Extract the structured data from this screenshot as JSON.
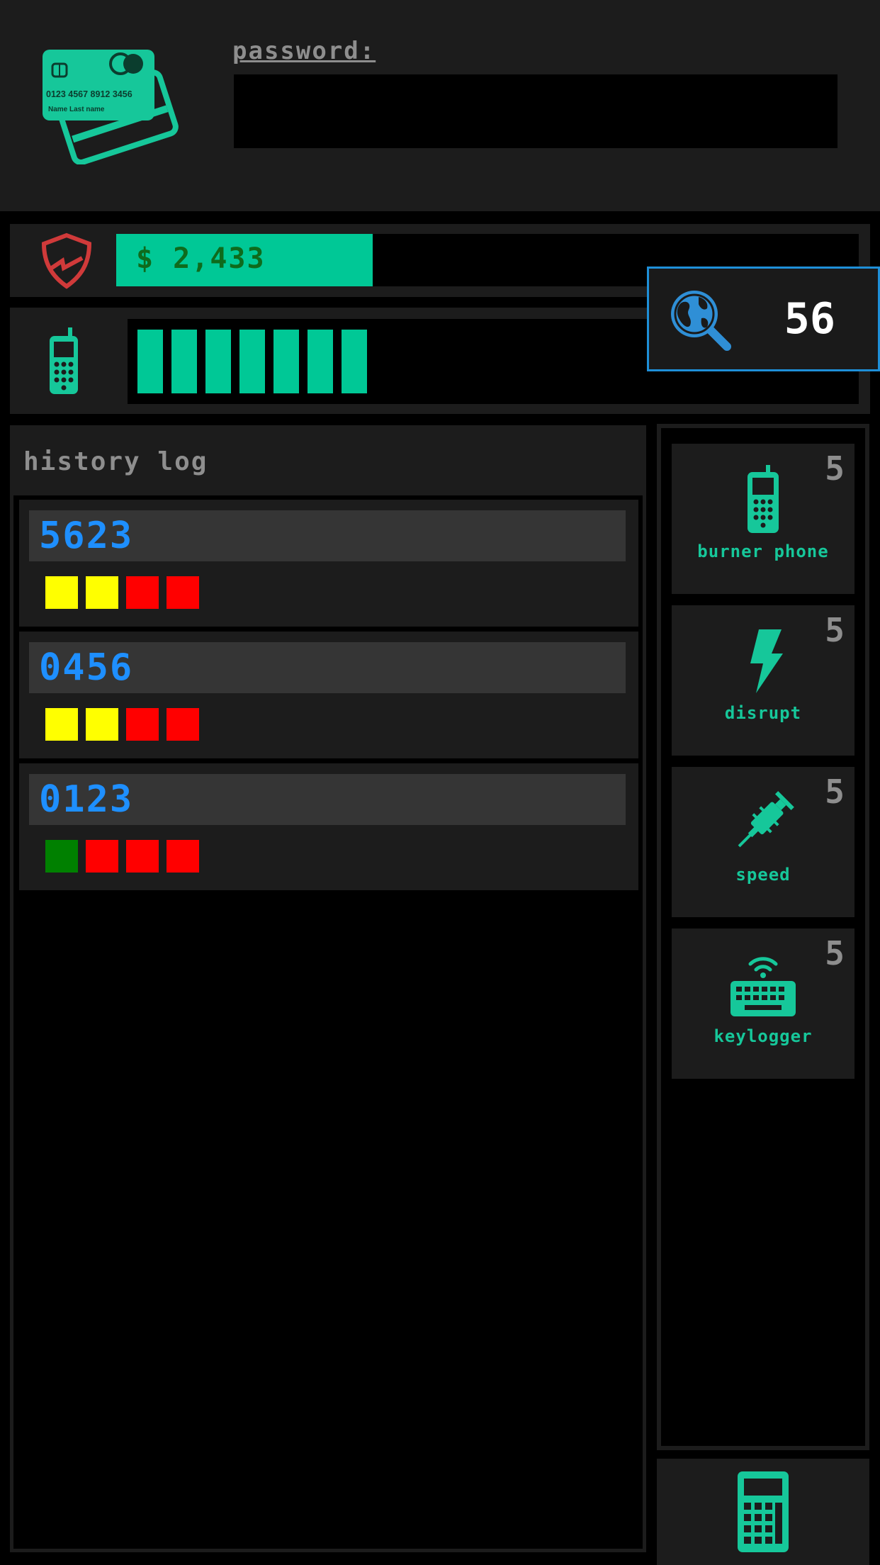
{
  "header": {
    "card_icon": "credit-cards-icon",
    "card_text": {
      "number": "0123 4567 8912 3456",
      "name": "Name  Last name"
    },
    "password_label": "password:",
    "password_value": ""
  },
  "money": {
    "icon": "shield-icon",
    "text": "$ 2,433",
    "bar_fill_fraction": 0.345
  },
  "signal": {
    "icon": "phone-icon",
    "bars": 7
  },
  "trace": {
    "icon": "globe-search-icon",
    "value": "56"
  },
  "history": {
    "title": "history log",
    "entries": [
      {
        "code": "5623",
        "squares": [
          "yellow",
          "yellow",
          "red",
          "red"
        ]
      },
      {
        "code": "0456",
        "squares": [
          "yellow",
          "yellow",
          "red",
          "red"
        ]
      },
      {
        "code": "0123",
        "squares": [
          "green",
          "red",
          "red",
          "red"
        ]
      }
    ]
  },
  "tools": [
    {
      "icon": "burner-phone-icon",
      "label": "burner phone",
      "count": "5"
    },
    {
      "icon": "lightning-icon",
      "label": "disrupt",
      "count": "5"
    },
    {
      "icon": "syringe-icon",
      "label": "speed",
      "count": "5"
    },
    {
      "icon": "keyboard-wifi-icon",
      "label": "keylogger",
      "count": "5"
    }
  ],
  "calculator": {
    "icon": "calculator-icon"
  },
  "colors": {
    "accent": "#00c896",
    "code_blue": "#1e8fff",
    "yellow": "#ffff00",
    "red": "#ff0000",
    "green": "#008000"
  }
}
